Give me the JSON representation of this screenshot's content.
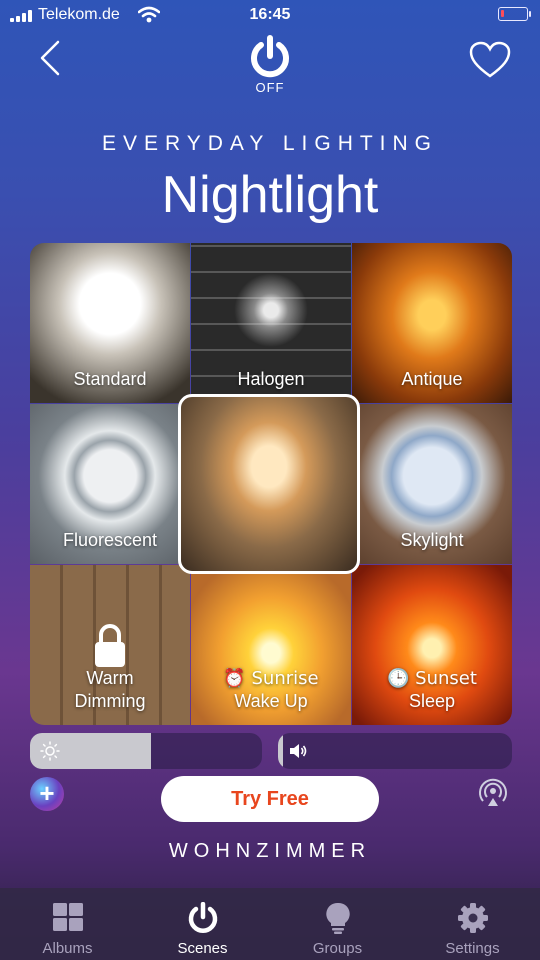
{
  "status_bar": {
    "carrier": "Telekom.de",
    "time": "16:45",
    "battery_color": "#ff4d5a"
  },
  "header": {
    "power_state": "OFF"
  },
  "scene": {
    "category": "EVERYDAY LIGHTING",
    "title": "Nightlight"
  },
  "tiles": [
    {
      "label": "Standard"
    },
    {
      "label": "Halogen"
    },
    {
      "label": "Antique"
    },
    {
      "label": "Fluorescent"
    },
    {
      "label": "Skylight"
    },
    {
      "label": "Warm Dimming",
      "line1": "Warm",
      "line2": "Dimming",
      "locked": true
    },
    {
      "label": "Sunrise Wake Up",
      "line1": "⏰ Sunrise",
      "line2": "Wake Up"
    },
    {
      "label": "Sunset Sleep",
      "line1": "🕒 Sunset",
      "line2": "Sleep"
    }
  ],
  "selected_tile": "Nightlight",
  "sliders": {
    "brightness_fraction": 0.52,
    "volume_fraction": 0.02
  },
  "try_button": {
    "label": "Try Free",
    "color": "#e8461e"
  },
  "room": "WOHNZIMMER",
  "tabbar": {
    "tabs": [
      {
        "label": "Albums",
        "icon": "albums-icon",
        "active": false
      },
      {
        "label": "Scenes",
        "icon": "power-icon",
        "active": true
      },
      {
        "label": "Groups",
        "icon": "bulb-icon",
        "active": false
      },
      {
        "label": "Settings",
        "icon": "gear-icon",
        "active": false
      }
    ]
  }
}
